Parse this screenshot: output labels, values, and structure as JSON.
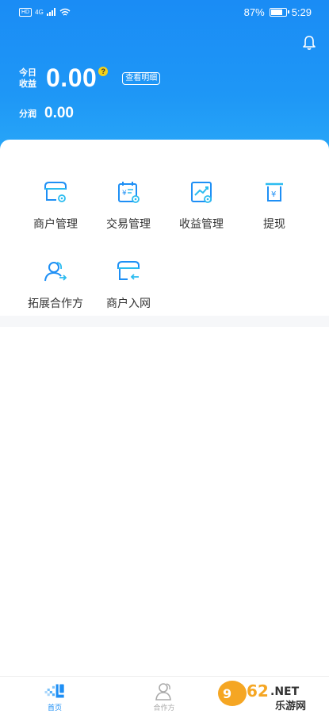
{
  "status_bar": {
    "hd": "HD",
    "network": "4G",
    "battery_percent": "87%",
    "battery_level": 0.87,
    "time": "5:29"
  },
  "header": {
    "today_earnings_label": "今日收益",
    "today_earnings_value": "0.00",
    "help_mark": "?",
    "detail_button": "查看明细",
    "profit_share_label": "分润",
    "profit_share_value": "0.00"
  },
  "menu": [
    {
      "label": "商户管理",
      "icon": "merchant-store-gear-icon"
    },
    {
      "label": "交易管理",
      "icon": "transaction-calendar-icon"
    },
    {
      "label": "收益管理",
      "icon": "earnings-chart-icon"
    },
    {
      "label": "提现",
      "icon": "withdraw-cash-icon"
    },
    {
      "label": "拓展合作方",
      "icon": "partner-expand-icon"
    },
    {
      "label": "商户入网",
      "icon": "merchant-onboard-icon"
    }
  ],
  "bottom_nav": [
    {
      "label": "首页",
      "active": true,
      "icon": "home-icon"
    },
    {
      "label": "合作方",
      "active": false,
      "icon": "partner-icon"
    }
  ],
  "watermark": {
    "text_top": "962.NET",
    "text_bottom": "乐游网"
  },
  "colors": {
    "primary": "#1e8ff5",
    "icon_blue": "#1e8ff5",
    "icon_cyan": "#2bbcf0",
    "help_yellow": "#f3d21b"
  }
}
